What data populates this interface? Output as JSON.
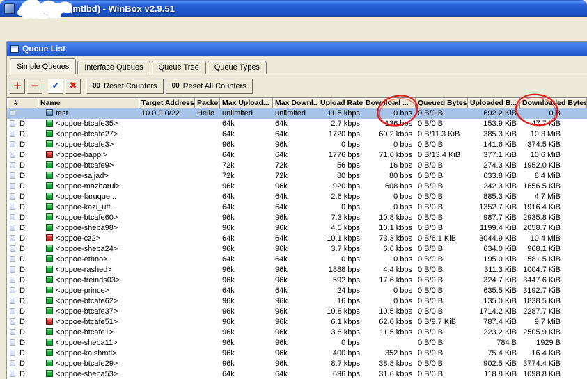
{
  "window": {
    "title": "(mtlbd) - WinBox v2.9.51"
  },
  "queue_window": {
    "title": "Queue List",
    "tabs": [
      {
        "label": "Simple Queues",
        "active": true
      },
      {
        "label": "Interface Queues",
        "active": false
      },
      {
        "label": "Queue Tree",
        "active": false
      },
      {
        "label": "Queue Types",
        "active": false
      }
    ],
    "toolbar": {
      "add_label": "+",
      "remove_label": "−",
      "enable_label": "✔",
      "disable_label": "✖",
      "counter_icon": "00",
      "reset_counters": "Reset Counters",
      "reset_all_counters": "Reset All Counters"
    }
  },
  "table": {
    "columns": [
      "#",
      "Name",
      "Target Address",
      "Packet ...",
      "Max Upload...",
      "Max Downl...",
      "Upload Rate",
      "Download ...",
      "Queued Bytes",
      "Uploaded B...",
      "Downloaded Bytes"
    ],
    "rows": [
      {
        "flag": "",
        "icon": "blue",
        "name": "test",
        "target": "10.0.0.0/22",
        "packet": "Hello",
        "max_upload": "unlimited",
        "max_download": "unlimited",
        "upload_rate": "11.5 kbps",
        "download_rate": "0 bps",
        "queued_bytes": "0 B/0 B",
        "uploaded_bytes": "692.2 KiB",
        "downloaded_bytes": "0 B",
        "selected": true
      },
      {
        "flag": "D",
        "icon": "green",
        "name": "<pppoe-btcafe35>",
        "target": "",
        "packet": "",
        "max_upload": "64k",
        "max_download": "64k",
        "upload_rate": "2.7 kbps",
        "download_rate": "136 bps",
        "queued_bytes": "0 B/0 B",
        "uploaded_bytes": "153.9 KiB",
        "downloaded_bytes": "47.7 KiB"
      },
      {
        "flag": "D",
        "icon": "green",
        "name": "<pppoe-btcafe27>",
        "target": "",
        "packet": "",
        "max_upload": "64k",
        "max_download": "64k",
        "upload_rate": "1720 bps",
        "download_rate": "60.2 kbps",
        "queued_bytes": "0 B/11.3 KiB",
        "uploaded_bytes": "385.3 KiB",
        "downloaded_bytes": "10.3 MiB"
      },
      {
        "flag": "D",
        "icon": "green",
        "name": "<pppoe-btcafe3>",
        "target": "",
        "packet": "",
        "max_upload": "96k",
        "max_download": "96k",
        "upload_rate": "0 bps",
        "download_rate": "0 bps",
        "queued_bytes": "0 B/0 B",
        "uploaded_bytes": "141.6 KiB",
        "downloaded_bytes": "374.5 KiB"
      },
      {
        "flag": "D",
        "icon": "red",
        "name": "<pppoe-bappi>",
        "target": "",
        "packet": "",
        "max_upload": "64k",
        "max_download": "64k",
        "upload_rate": "1776 bps",
        "download_rate": "71.6 kbps",
        "queued_bytes": "0 B/13.4 KiB",
        "uploaded_bytes": "377.1 KiB",
        "downloaded_bytes": "10.6 MiB"
      },
      {
        "flag": "D",
        "icon": "green",
        "name": "<pppoe-btcafe9>",
        "target": "",
        "packet": "",
        "max_upload": "72k",
        "max_download": "72k",
        "upload_rate": "56 bps",
        "download_rate": "16 bps",
        "queued_bytes": "0 B/0 B",
        "uploaded_bytes": "274.3 KiB",
        "downloaded_bytes": "1952.0 KiB"
      },
      {
        "flag": "D",
        "icon": "green",
        "name": "<pppoe-sajjad>",
        "target": "",
        "packet": "",
        "max_upload": "72k",
        "max_download": "72k",
        "upload_rate": "80 bps",
        "download_rate": "80 bps",
        "queued_bytes": "0 B/0 B",
        "uploaded_bytes": "633.8 KiB",
        "downloaded_bytes": "8.4 MiB"
      },
      {
        "flag": "D",
        "icon": "green",
        "name": "<pppoe-mazharul>",
        "target": "",
        "packet": "",
        "max_upload": "96k",
        "max_download": "96k",
        "upload_rate": "920 bps",
        "download_rate": "608 bps",
        "queued_bytes": "0 B/0 B",
        "uploaded_bytes": "242.3 KiB",
        "downloaded_bytes": "1656.5 KiB"
      },
      {
        "flag": "D",
        "icon": "green",
        "name": "<pppoe-faruque...",
        "target": "",
        "packet": "",
        "max_upload": "64k",
        "max_download": "64k",
        "upload_rate": "2.6 kbps",
        "download_rate": "0 bps",
        "queued_bytes": "0 B/0 B",
        "uploaded_bytes": "885.3 KiB",
        "downloaded_bytes": "4.7 MiB"
      },
      {
        "flag": "D",
        "icon": "green",
        "name": "<pppoe-kazi_utt...",
        "target": "",
        "packet": "",
        "max_upload": "64k",
        "max_download": "64k",
        "upload_rate": "0 bps",
        "download_rate": "0 bps",
        "queued_bytes": "0 B/0 B",
        "uploaded_bytes": "1352.7 KiB",
        "downloaded_bytes": "1916.4 KiB"
      },
      {
        "flag": "D",
        "icon": "green",
        "name": "<pppoe-btcafe60>",
        "target": "",
        "packet": "",
        "max_upload": "96k",
        "max_download": "96k",
        "upload_rate": "7.3 kbps",
        "download_rate": "10.8 kbps",
        "queued_bytes": "0 B/0 B",
        "uploaded_bytes": "987.7 KiB",
        "downloaded_bytes": "2935.8 KiB"
      },
      {
        "flag": "D",
        "icon": "green",
        "name": "<pppoe-sheba98>",
        "target": "",
        "packet": "",
        "max_upload": "96k",
        "max_download": "96k",
        "upload_rate": "4.5 kbps",
        "download_rate": "10.1 kbps",
        "queued_bytes": "0 B/0 B",
        "uploaded_bytes": "1199.4 KiB",
        "downloaded_bytes": "2058.7 KiB"
      },
      {
        "flag": "D",
        "icon": "red",
        "name": "<pppoe-cz2>",
        "target": "",
        "packet": "",
        "max_upload": "64k",
        "max_download": "64k",
        "upload_rate": "10.1 kbps",
        "download_rate": "73.3 kbps",
        "queued_bytes": "0 B/6.1 KiB",
        "uploaded_bytes": "3044.9 KiB",
        "downloaded_bytes": "10.4 MiB"
      },
      {
        "flag": "D",
        "icon": "green",
        "name": "<pppoe-sheba24>",
        "target": "",
        "packet": "",
        "max_upload": "96k",
        "max_download": "96k",
        "upload_rate": "3.7 kbps",
        "download_rate": "6.6 kbps",
        "queued_bytes": "0 B/0 B",
        "uploaded_bytes": "634.0 KiB",
        "downloaded_bytes": "968.1 KiB"
      },
      {
        "flag": "D",
        "icon": "green",
        "name": "<pppoe-ethno>",
        "target": "",
        "packet": "",
        "max_upload": "64k",
        "max_download": "64k",
        "upload_rate": "0 bps",
        "download_rate": "0 bps",
        "queued_bytes": "0 B/0 B",
        "uploaded_bytes": "195.0 KiB",
        "downloaded_bytes": "581.5 KiB"
      },
      {
        "flag": "D",
        "icon": "green",
        "name": "<pppoe-rashed>",
        "target": "",
        "packet": "",
        "max_upload": "96k",
        "max_download": "96k",
        "upload_rate": "1888 bps",
        "download_rate": "4.4 kbps",
        "queued_bytes": "0 B/0 B",
        "uploaded_bytes": "311.3 KiB",
        "downloaded_bytes": "1004.7 KiB"
      },
      {
        "flag": "D",
        "icon": "green",
        "name": "<pppoe-freinds03>",
        "target": "",
        "packet": "",
        "max_upload": "96k",
        "max_download": "96k",
        "upload_rate": "592 bps",
        "download_rate": "17.6 kbps",
        "queued_bytes": "0 B/0 B",
        "uploaded_bytes": "324.7 KiB",
        "downloaded_bytes": "3447.6 KiB"
      },
      {
        "flag": "D",
        "icon": "green",
        "name": "<pppoe-prince>",
        "target": "",
        "packet": "",
        "max_upload": "64k",
        "max_download": "64k",
        "upload_rate": "24 bps",
        "download_rate": "0 bps",
        "queued_bytes": "0 B/0 B",
        "uploaded_bytes": "635.5 KiB",
        "downloaded_bytes": "3192.7 KiB"
      },
      {
        "flag": "D",
        "icon": "green",
        "name": "<pppoe-btcafe62>",
        "target": "",
        "packet": "",
        "max_upload": "96k",
        "max_download": "96k",
        "upload_rate": "16 bps",
        "download_rate": "0 bps",
        "queued_bytes": "0 B/0 B",
        "uploaded_bytes": "135.0 KiB",
        "downloaded_bytes": "1838.5 KiB"
      },
      {
        "flag": "D",
        "icon": "green",
        "name": "<pppoe-btcafe37>",
        "target": "",
        "packet": "",
        "max_upload": "96k",
        "max_download": "96k",
        "upload_rate": "10.8 kbps",
        "download_rate": "10.5 kbps",
        "queued_bytes": "0 B/0 B",
        "uploaded_bytes": "1714.2 KiB",
        "downloaded_bytes": "2287.7 KiB"
      },
      {
        "flag": "D",
        "icon": "red",
        "name": "<pppoe-btcafe51>",
        "target": "",
        "packet": "",
        "max_upload": "96k",
        "max_download": "96k",
        "upload_rate": "6.1 kbps",
        "download_rate": "62.0 kbps",
        "queued_bytes": "0 B/9.7 KiB",
        "uploaded_bytes": "787.4 KiB",
        "downloaded_bytes": "9.7 MiB"
      },
      {
        "flag": "D",
        "icon": "green",
        "name": "<pppoe-btcafe1>",
        "target": "",
        "packet": "",
        "max_upload": "96k",
        "max_download": "96k",
        "upload_rate": "3.8 kbps",
        "download_rate": "11.5 kbps",
        "queued_bytes": "0 B/0 B",
        "uploaded_bytes": "223.2 KiB",
        "downloaded_bytes": "2505.9 KiB"
      },
      {
        "flag": "D",
        "icon": "green",
        "name": "<pppoe-sheba11>",
        "target": "",
        "packet": "",
        "max_upload": "96k",
        "max_download": "96k",
        "upload_rate": "0 bps",
        "download_rate": "",
        "queued_bytes": "0 B/0 B",
        "uploaded_bytes": "784 B",
        "downloaded_bytes": "1929 B"
      },
      {
        "flag": "D",
        "icon": "green",
        "name": "<pppoe-kaishmtl>",
        "target": "",
        "packet": "",
        "max_upload": "96k",
        "max_download": "96k",
        "upload_rate": "400 bps",
        "download_rate": "352 bps",
        "queued_bytes": "0 B/0 B",
        "uploaded_bytes": "75.4 KiB",
        "downloaded_bytes": "16.4 KiB"
      },
      {
        "flag": "D",
        "icon": "green",
        "name": "<pppoe-btcafe29>",
        "target": "",
        "packet": "",
        "max_upload": "96k",
        "max_download": "96k",
        "upload_rate": "8.7 kbps",
        "download_rate": "38.8 kbps",
        "queued_bytes": "0 B/0 B",
        "uploaded_bytes": "902.5 KiB",
        "downloaded_bytes": "3774.4 KiB"
      },
      {
        "flag": "D",
        "icon": "green",
        "name": "<pppoe-sheba53>",
        "target": "",
        "packet": "",
        "max_upload": "64k",
        "max_download": "64k",
        "upload_rate": "696 bps",
        "download_rate": "31.6 kbps",
        "queued_bytes": "0 B/0 B",
        "uploaded_bytes": "118.8 KiB",
        "downloaded_bytes": "1098.8 KiB"
      }
    ]
  },
  "annotations": {
    "circle_1_target": "download-rate-first-row",
    "circle_2_target": "downloaded-bytes-first-row",
    "color": "#e02020"
  },
  "colors": {
    "titlebar_blue": "#2b64da",
    "selection_blue": "#A8C3E8",
    "queue_icon_green": "#18953a",
    "queue_icon_red": "#b02323",
    "annotation_red": "#e02020",
    "window_face": "#ECE9D8"
  }
}
